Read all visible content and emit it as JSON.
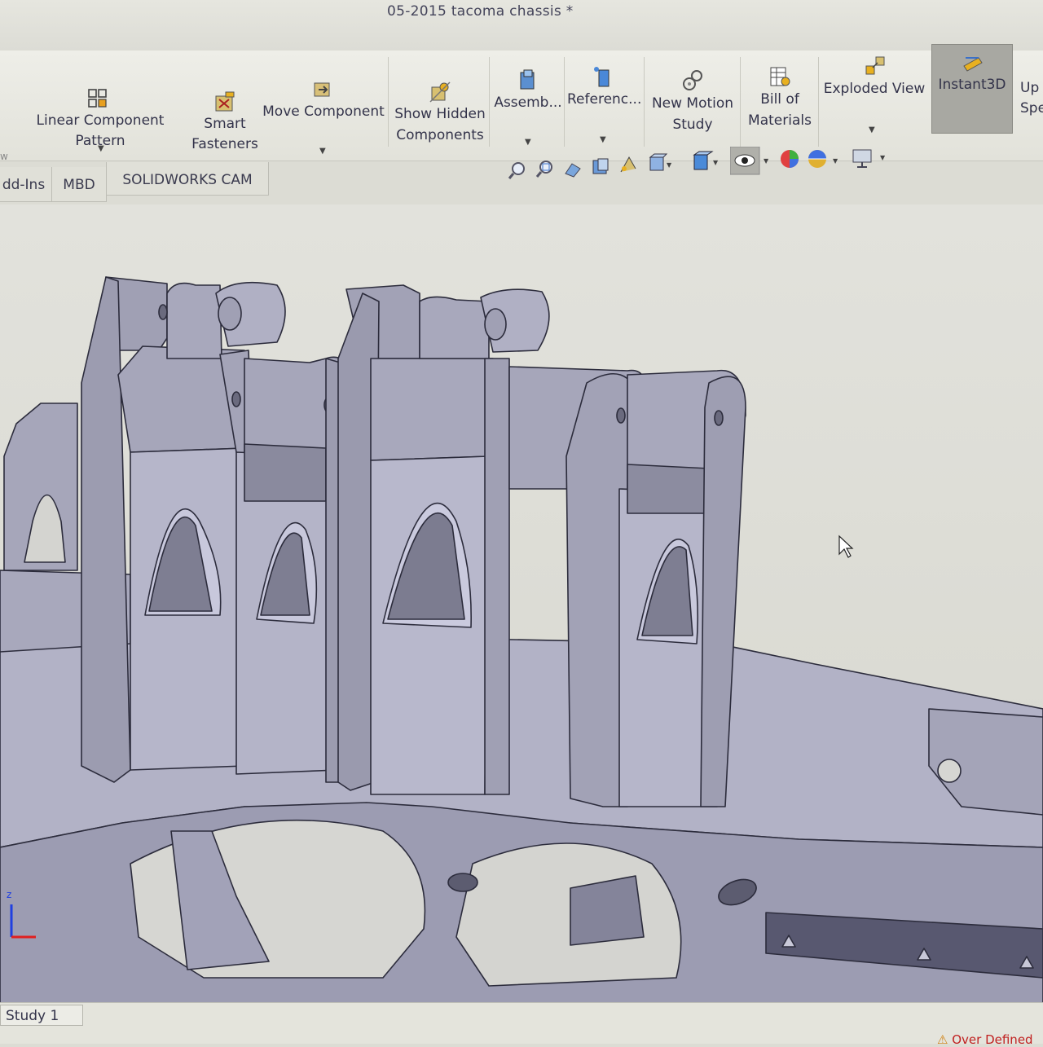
{
  "window": {
    "title": "05-2015 tacoma chassis *"
  },
  "ribbon": {
    "left_cut_label": "w",
    "buttons": [
      {
        "id": "linear-component-pattern",
        "label": "Linear Component Pattern",
        "icon": "pattern-grid-icon",
        "has_dropdown": true
      },
      {
        "id": "smart-fasteners",
        "label_line1": "Smart",
        "label_line2": "Fasteners",
        "icon": "fastener-icon",
        "has_dropdown": false
      },
      {
        "id": "move-component",
        "label": "Move Component",
        "icon": "move-component-icon",
        "has_dropdown": true
      },
      {
        "id": "show-hidden-components",
        "label_line1": "Show Hidden",
        "label_line2": "Components",
        "icon": "show-hidden-icon",
        "has_dropdown": false
      },
      {
        "id": "assembly",
        "label": "Assemb...",
        "icon": "assembly-features-icon",
        "has_dropdown": true
      },
      {
        "id": "reference",
        "label": "Referenc...",
        "icon": "reference-geometry-icon",
        "has_dropdown": true
      },
      {
        "id": "new-motion-study",
        "label_line1": "New Motion",
        "label_line2": "Study",
        "icon": "motion-study-icon",
        "has_dropdown": false
      },
      {
        "id": "bill-of-materials",
        "label_line1": "Bill of",
        "label_line2": "Materials",
        "icon": "bom-icon",
        "has_dropdown": false
      },
      {
        "id": "exploded-view",
        "label": "Exploded View",
        "icon": "exploded-view-icon",
        "has_dropdown": true
      },
      {
        "id": "instant3d",
        "label": "Instant3D",
        "icon": "instant3d-icon",
        "active": true
      },
      {
        "id": "update-speedpak",
        "label_line1": "Up",
        "label_line2": "Spe",
        "icon": "speedpak-icon"
      }
    ]
  },
  "tabs": [
    {
      "label": "dd-Ins"
    },
    {
      "label": "MBD"
    },
    {
      "label": "SOLIDWORKS CAM"
    }
  ],
  "view_toolbar": [
    "zoom-to-fit-icon",
    "zoom-to-area-icon",
    "previous-view-icon",
    "section-view-icon",
    "dynamic-annotation-icon",
    "view-orientation-icon",
    "display-style-icon",
    "hide-show-items-icon",
    "edit-appearance-icon",
    "apply-scene-icon",
    "view-settings-icon"
  ],
  "viewport": {
    "model": "05-2015 tacoma chassis",
    "triad_axis_label": "z"
  },
  "status": {
    "study_tab": "Study 1",
    "message": "Over Defined",
    "message_color": "#c02020"
  },
  "colors": {
    "model_face": "#a9a9be",
    "model_edge": "#2c2c3c",
    "background": "#dcdcd4",
    "active_button": "#a8a8a2"
  }
}
